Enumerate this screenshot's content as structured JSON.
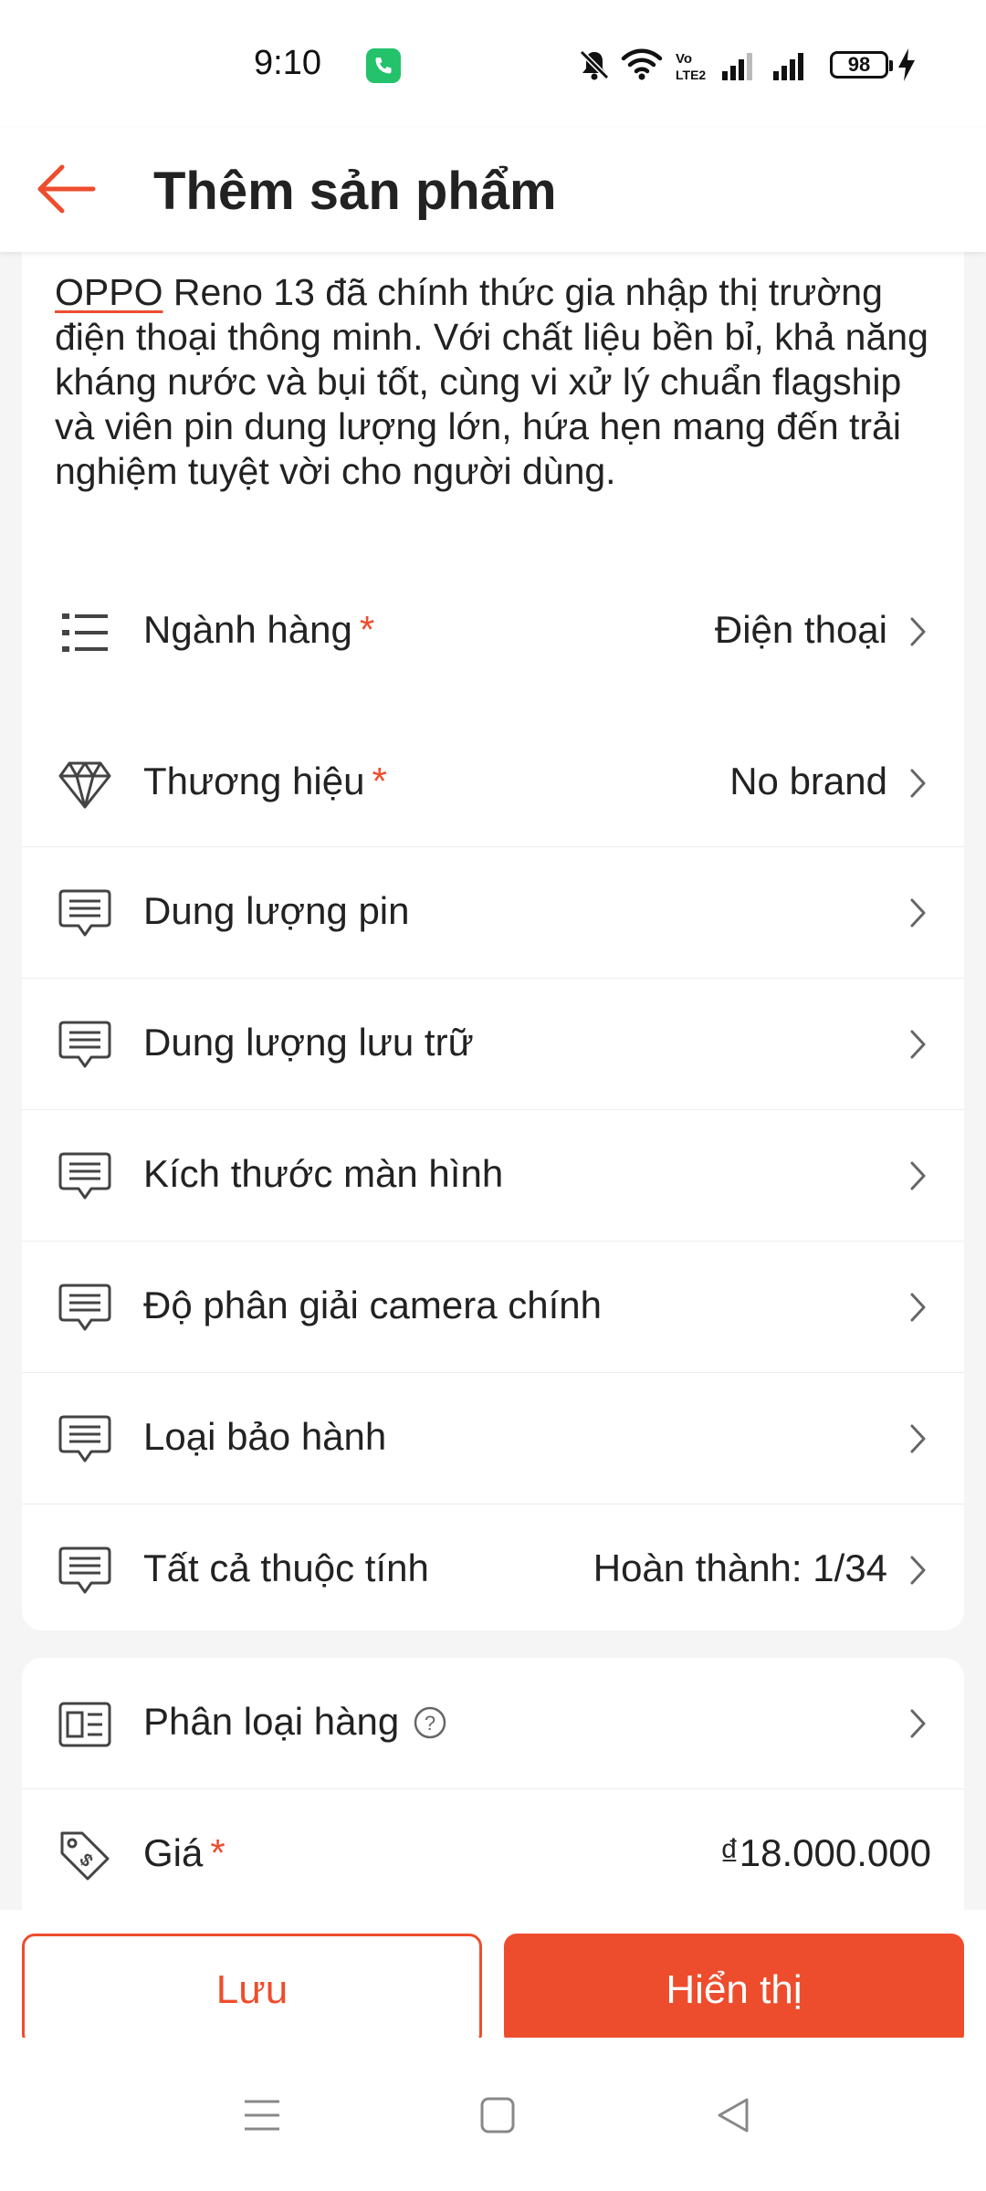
{
  "status_bar": {
    "time": "9:10",
    "battery": "98",
    "icons": [
      "phone-call-icon",
      "bell-off-icon",
      "wifi-icon",
      "volte-icon",
      "signal-icon",
      "signal-icon",
      "battery-icon",
      "charging-icon"
    ]
  },
  "header": {
    "title": "Thêm sản phẩm",
    "back_icon": "arrow-left-icon"
  },
  "description": {
    "brand_word": "OPPO",
    "text": " Reno 13 đã chính thức gia nhập thị trường điện thoại thông minh. Với chất liệu bền bỉ, khả năng kháng nước và bụi tốt, cùng vi xử lý chuẩn flagship và viên pin dung lượng lớn, hứa hẹn mang đến trải nghiệm tuyệt vời cho người dùng."
  },
  "category": {
    "label": "Ngành hàng",
    "required_mark": "*",
    "value": "Điện thoại",
    "icon": "list-icon"
  },
  "attributes": [
    {
      "label": "Thương hiệu",
      "required_mark": "*",
      "value": "No brand",
      "icon": "diamond-icon"
    },
    {
      "label": "Dung lượng pin",
      "required_mark": "",
      "value": "",
      "icon": "message-icon"
    },
    {
      "label": "Dung lượng lưu trữ",
      "required_mark": "",
      "value": "",
      "icon": "message-icon"
    },
    {
      "label": "Kích thước màn hình",
      "required_mark": "",
      "value": "",
      "icon": "message-icon"
    },
    {
      "label": "Độ phân giải camera chính",
      "required_mark": "",
      "value": "",
      "icon": "message-icon"
    },
    {
      "label": "Loại bảo hành",
      "required_mark": "",
      "value": "",
      "icon": "message-icon"
    },
    {
      "label": "Tất cả thuộc tính",
      "required_mark": "",
      "value": "Hoàn thành: 1/34",
      "icon": "message-icon"
    }
  ],
  "variants": {
    "label": "Phân loại hàng",
    "help_icon": "question-circle-icon",
    "icon": "variant-icon"
  },
  "price": {
    "label": "Giá",
    "required_mark": "*",
    "value": "₫18.000.000",
    "icon": "price-tag-icon"
  },
  "actions": {
    "save_label": "Lưu",
    "show_label": "Hiển thị"
  },
  "nav": [
    "menu-icon",
    "home-square-icon",
    "back-triangle-icon"
  ],
  "colors": {
    "accent": "#ee4d2d",
    "background": "#f5f5f5",
    "card": "#ffffff",
    "text": "#222222"
  }
}
